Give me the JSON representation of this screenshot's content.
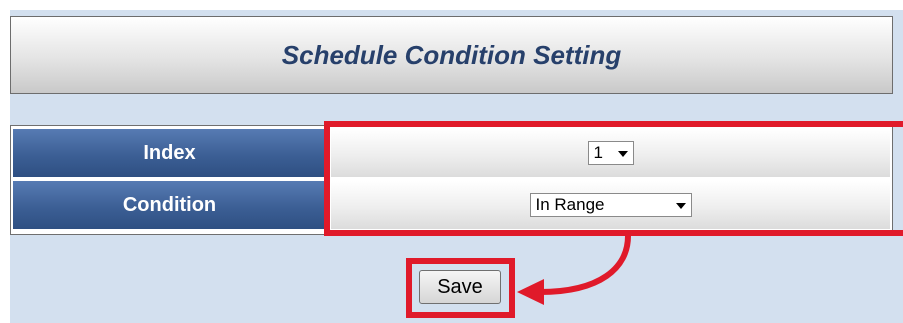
{
  "title": "Schedule Condition Setting",
  "form": {
    "index_label": "Index",
    "index_value": "1",
    "condition_label": "Condition",
    "condition_value": "In Range"
  },
  "save_label": "Save",
  "colors": {
    "highlight": "#e01a2a",
    "label_bg": "#3c5f95",
    "title_text": "#27406b",
    "panel_bg": "#d3e0ef"
  },
  "icons": [
    "dropdown-arrow-icon",
    "callout-arrow-icon"
  ]
}
